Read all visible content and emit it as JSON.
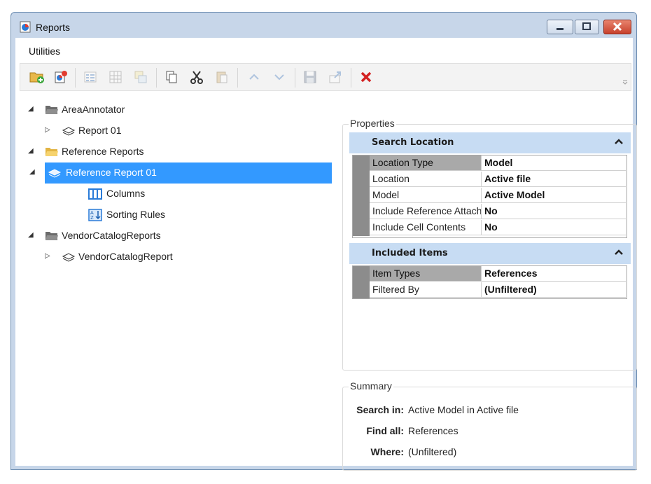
{
  "window": {
    "title": "Reports",
    "title_icon": "reports-app-icon"
  },
  "menu": {
    "utilities": "Utilities"
  },
  "toolbar": {
    "buttons": [
      {
        "name": "new-folder-button",
        "icon": "folder-add-icon",
        "enabled": true
      },
      {
        "name": "new-report-button",
        "icon": "report-add-icon",
        "enabled": true
      },
      {
        "name": "list-button",
        "icon": "list-icon",
        "enabled": false
      },
      {
        "name": "grid-button",
        "icon": "grid-icon",
        "enabled": false
      },
      {
        "name": "filter-button",
        "icon": "filter-icon",
        "enabled": false
      },
      {
        "name": "copy-button",
        "icon": "copy-icon",
        "enabled": true
      },
      {
        "name": "cut-button",
        "icon": "scissors-icon",
        "enabled": true
      },
      {
        "name": "paste-button",
        "icon": "paste-icon",
        "enabled": false
      },
      {
        "name": "move-up-button",
        "icon": "chevron-up-icon",
        "enabled": false
      },
      {
        "name": "move-down-button",
        "icon": "chevron-down-icon",
        "enabled": false
      },
      {
        "name": "save-button",
        "icon": "save-icon",
        "enabled": false
      },
      {
        "name": "export-button",
        "icon": "export-icon",
        "enabled": false
      },
      {
        "name": "delete-button",
        "icon": "red-x-icon",
        "enabled": true
      }
    ]
  },
  "tree": {
    "n0": "AreaAnnotator",
    "n1": "Report 01",
    "n2": "Reference Reports",
    "n3": "Reference Report 01",
    "n4": "Columns",
    "n5": "Sorting Rules",
    "n6": "VendorCatalogReports",
    "n7": "VendorCatalogReport"
  },
  "properties": {
    "title": "Properties",
    "search_location": {
      "header": "Search Location",
      "rows": [
        {
          "name": "Location Type",
          "value": "Model"
        },
        {
          "name": "Location",
          "value": "Active file"
        },
        {
          "name": "Model",
          "value": "Active Model"
        },
        {
          "name": "Include Reference Attachments",
          "value": "No"
        },
        {
          "name": "Include Cell Contents",
          "value": "No"
        }
      ]
    },
    "included_items": {
      "header": "Included Items",
      "rows": [
        {
          "name": "Item Types",
          "value": "References"
        },
        {
          "name": "Filtered By",
          "value": "(Unfiltered)"
        }
      ]
    }
  },
  "summary": {
    "title": "Summary",
    "search_in_label": "Search in:",
    "search_in_value": "Active Model  in Active file",
    "find_all_label": "Find all:",
    "find_all_value": "References",
    "where_label": "Where:",
    "where_value": "(Unfiltered)"
  },
  "colors": {
    "selection": "#3399ff",
    "section_header": "#c7dcf3",
    "delete": "#d32222"
  }
}
